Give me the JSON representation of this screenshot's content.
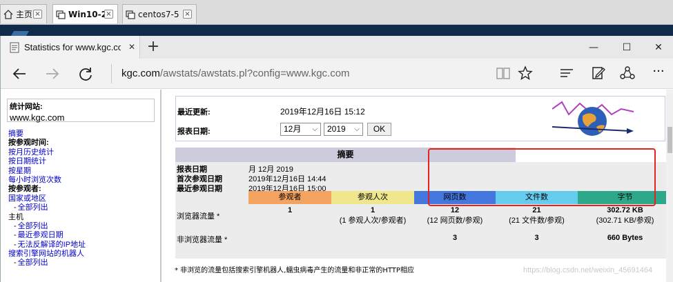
{
  "vm_tabs": [
    {
      "label": "主页",
      "icon": "home-icon"
    },
    {
      "label": "Win10-2",
      "icon": "vm-icon"
    },
    {
      "label": "centos7-5",
      "icon": "vm-icon"
    }
  ],
  "browser": {
    "tab_title": "Statistics for www.kgc.co",
    "new_tab": "+",
    "url_prefix": "kgc.com",
    "url_rest": "/awstats/awstats.pl?config=www.kgc.com"
  },
  "sidebar": {
    "site_label": "统计网站:",
    "site_value": "www.kgc.com",
    "items": [
      {
        "label": "摘要",
        "kind": "link"
      },
      {
        "label": "按参观时间:",
        "kind": "head"
      },
      {
        "label": "按月历史统计",
        "kind": "link"
      },
      {
        "label": "按日期统计",
        "kind": "link"
      },
      {
        "label": "按星期",
        "kind": "link"
      },
      {
        "label": "每小时浏览次数",
        "kind": "link"
      },
      {
        "label": "按参观者:",
        "kind": "head"
      },
      {
        "label": "国家或地区",
        "kind": "link"
      },
      {
        "label": "全部列出",
        "kind": "sub"
      },
      {
        "label": "主机",
        "kind": "link"
      },
      {
        "label": "全部列出",
        "kind": "sub"
      },
      {
        "label": "最近参观日期",
        "kind": "sub"
      },
      {
        "label": "无法反解译的IP地址",
        "kind": "sub"
      },
      {
        "label": "搜索引擎网站的机器人",
        "kind": "link"
      },
      {
        "label": "全部列出",
        "kind": "sub"
      }
    ]
  },
  "update": {
    "last_update_label": "最近更新:",
    "last_update_value": "2019年12月16日 15:12",
    "report_date_label": "报表日期:",
    "month": "12月",
    "year": "2019",
    "ok": "OK"
  },
  "summary": {
    "title": "摘要",
    "report_date_key": "报表日期",
    "report_date_val": "月 12月 2019",
    "first_visit_key": "首次参观日期",
    "first_visit_val": "2019年12月16日 14:44",
    "last_visit_key": "最近参观日期",
    "last_visit_val": "2019年12月16日 15:00",
    "columns": [
      "参观者",
      "参观人次",
      "网页数",
      "文件数",
      "字节"
    ],
    "column_colors": [
      "#f4a460",
      "#f0e68c",
      "#4477dd",
      "#66ccee",
      "#2ea88a"
    ],
    "rows": [
      {
        "label": "浏览器流量 *",
        "visitors": "1",
        "visits": "1",
        "visits_sub": "(1 参观人次/参观者)",
        "pages": "12",
        "pages_sub": "(12 网页数/参观)",
        "hits": "21",
        "hits_sub": "(21 文件数/参观)",
        "bytes": "302.72 KB",
        "bytes_sub": "(302.71 KB/参观)"
      },
      {
        "label": "非浏览器流量 *",
        "pages": "3",
        "hits": "3",
        "bytes": "660 Bytes"
      }
    ],
    "footnote": "* 非浏览的流量包括搜索引擎机器人,蠕虫病毒产生的流量和非正常的HTTP相应"
  },
  "watermark": "https://blog.csdn.net/weixin_45691464"
}
